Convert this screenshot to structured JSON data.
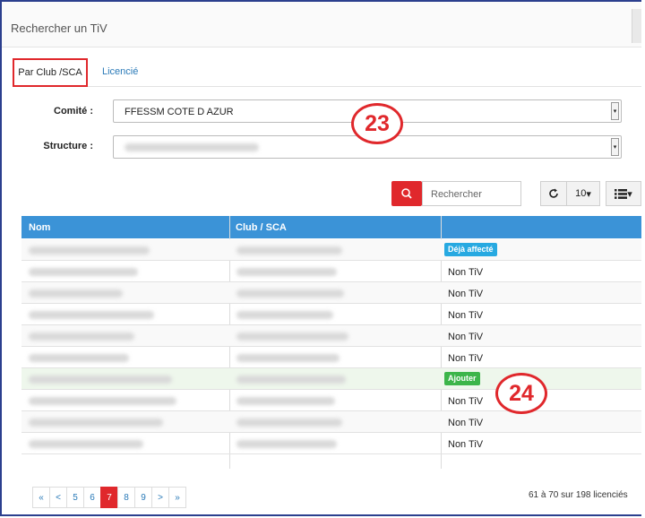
{
  "header": {
    "title": "Rechercher un TiV"
  },
  "tabs": [
    {
      "label": "Par Club /SCA",
      "active": true
    },
    {
      "label": "Licencié",
      "active": false
    }
  ],
  "form": {
    "comite_label": "Comité :",
    "comite_value": "FFESSM COTE D AZUR",
    "structure_label": "Structure :"
  },
  "toolbar": {
    "search_placeholder": "Rechercher",
    "page_size": "10",
    "refresh_icon": "refresh-icon",
    "columns_icon": "list-icon"
  },
  "table": {
    "columns": [
      "Nom",
      "Club / SCA",
      ""
    ],
    "rows": [
      {
        "status": "Déjà affecté",
        "kind": "badge",
        "color": "#27a9e1"
      },
      {
        "status": "Non TiV",
        "kind": "text"
      },
      {
        "status": "Non TiV",
        "kind": "text"
      },
      {
        "status": "Non TiV",
        "kind": "text"
      },
      {
        "status": "Non TiV",
        "kind": "text"
      },
      {
        "status": "Non TiV",
        "kind": "text"
      },
      {
        "status": "Ajouter",
        "kind": "button",
        "color": "#3cb54a"
      },
      {
        "status": "Non TiV",
        "kind": "text"
      },
      {
        "status": "Non TiV",
        "kind": "text"
      },
      {
        "status": "Non TiV",
        "kind": "text"
      }
    ]
  },
  "pagination": {
    "pages": [
      "«",
      "<",
      "5",
      "6",
      "7",
      "8",
      "9",
      ">",
      "»"
    ],
    "current": "7",
    "summary": "61 à 70 sur 198 licenciés"
  },
  "markers": {
    "a": "23",
    "b": "24"
  },
  "colors": {
    "accent_red": "#e0282c",
    "header_blue": "#3b93d7",
    "frame_blue": "#2b3f8e"
  }
}
